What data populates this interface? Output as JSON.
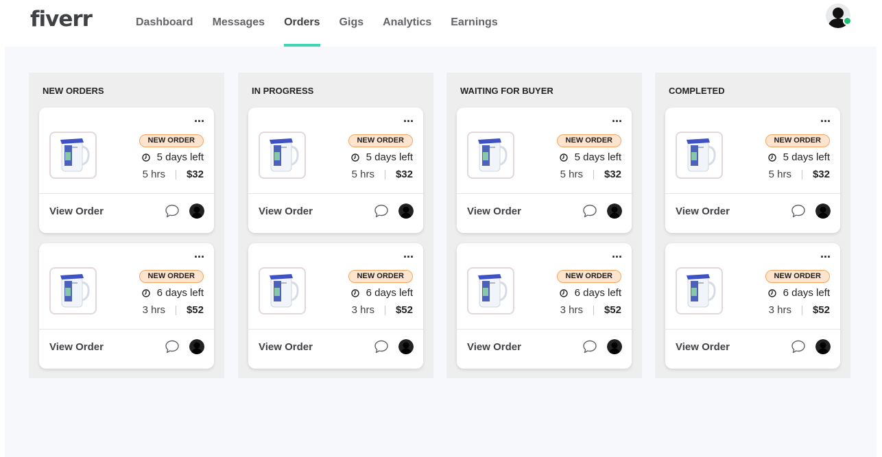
{
  "app": {
    "logo": "fiverr"
  },
  "nav": {
    "items": [
      {
        "label": "Dashboard"
      },
      {
        "label": "Messages"
      },
      {
        "label": "Orders",
        "active": true
      },
      {
        "label": "Gigs"
      },
      {
        "label": "Analytics"
      },
      {
        "label": "Earnings"
      }
    ]
  },
  "colors": {
    "accent": "#3fd6b4",
    "online": "#1dbf73",
    "badge_bg": "#fde4cf",
    "badge_border": "#f4a35e"
  },
  "columns": [
    {
      "title": "NEW ORDERS",
      "cards": [
        {
          "badge": "NEW ORDER",
          "time_left": "5 days left",
          "hours": "5 hrs",
          "price": "$32",
          "action": "View Order",
          "more": "..."
        },
        {
          "badge": "NEW ORDER",
          "time_left": "6 days left",
          "hours": "3 hrs",
          "price": "$52",
          "action": "View Order",
          "more": "..."
        }
      ]
    },
    {
      "title": "IN PROGRESS",
      "cards": [
        {
          "badge": "NEW ORDER",
          "time_left": "5 days left",
          "hours": "5 hrs",
          "price": "$32",
          "action": "View Order",
          "more": "..."
        },
        {
          "badge": "NEW ORDER",
          "time_left": "6 days left",
          "hours": "3 hrs",
          "price": "$52",
          "action": "View Order",
          "more": "..."
        }
      ]
    },
    {
      "title": "WAITING FOR BUYER",
      "cards": [
        {
          "badge": "NEW ORDER",
          "time_left": "5 days left",
          "hours": "5 hrs",
          "price": "$32",
          "action": "View Order",
          "more": "..."
        },
        {
          "badge": "NEW ORDER",
          "time_left": "6 days left",
          "hours": "3 hrs",
          "price": "$52",
          "action": "View Order",
          "more": "..."
        }
      ]
    },
    {
      "title": "COMPLETED",
      "cards": [
        {
          "badge": "NEW ORDER",
          "time_left": "5 days left",
          "hours": "5 hrs",
          "price": "$32",
          "action": "View Order",
          "more": "..."
        },
        {
          "badge": "NEW ORDER",
          "time_left": "6 days left",
          "hours": "3 hrs",
          "price": "$52",
          "action": "View Order",
          "more": "..."
        }
      ]
    }
  ]
}
